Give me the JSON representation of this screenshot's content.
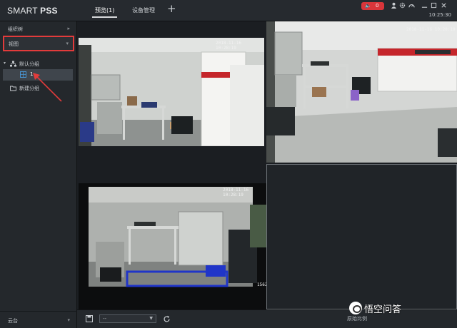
{
  "app": {
    "logo_prefix": "SMART ",
    "logo_bold": "PSS"
  },
  "tabs": [
    {
      "label": "预览(1)",
      "active": true
    },
    {
      "label": "设备管理",
      "active": false
    }
  ],
  "add_tab_label": "+",
  "topbar": {
    "alarm_count": "0",
    "icons": [
      "speaker-icon",
      "user-icon",
      "settings-icon",
      "dashboard-icon"
    ],
    "time": "10:25:30"
  },
  "sidebar": {
    "org_tree_label": "组织树",
    "view_label": "视图",
    "tree": {
      "default_group": "默认分组",
      "selected_item": "1",
      "new_group": "新建分组"
    },
    "ptz_label": "云台"
  },
  "video": {
    "cells": [
      {
        "timestamp": "2018-11-16 10:28:19",
        "channel": ""
      },
      {
        "timestamp": "2018-11-16 10:28:19",
        "channel": ""
      },
      {
        "timestamp": "2018-11-16 10:28:19",
        "channel": "1562"
      },
      {
        "timestamp": "",
        "channel": ""
      }
    ]
  },
  "bottombar": {
    "stream_value": "--",
    "ratio_label": "原始比例"
  },
  "watermark": {
    "text": "悟空问答"
  },
  "colors": {
    "accent_red": "#e23b3b",
    "alarm_red": "#d8353a",
    "selection_bg": "#3f454c"
  }
}
